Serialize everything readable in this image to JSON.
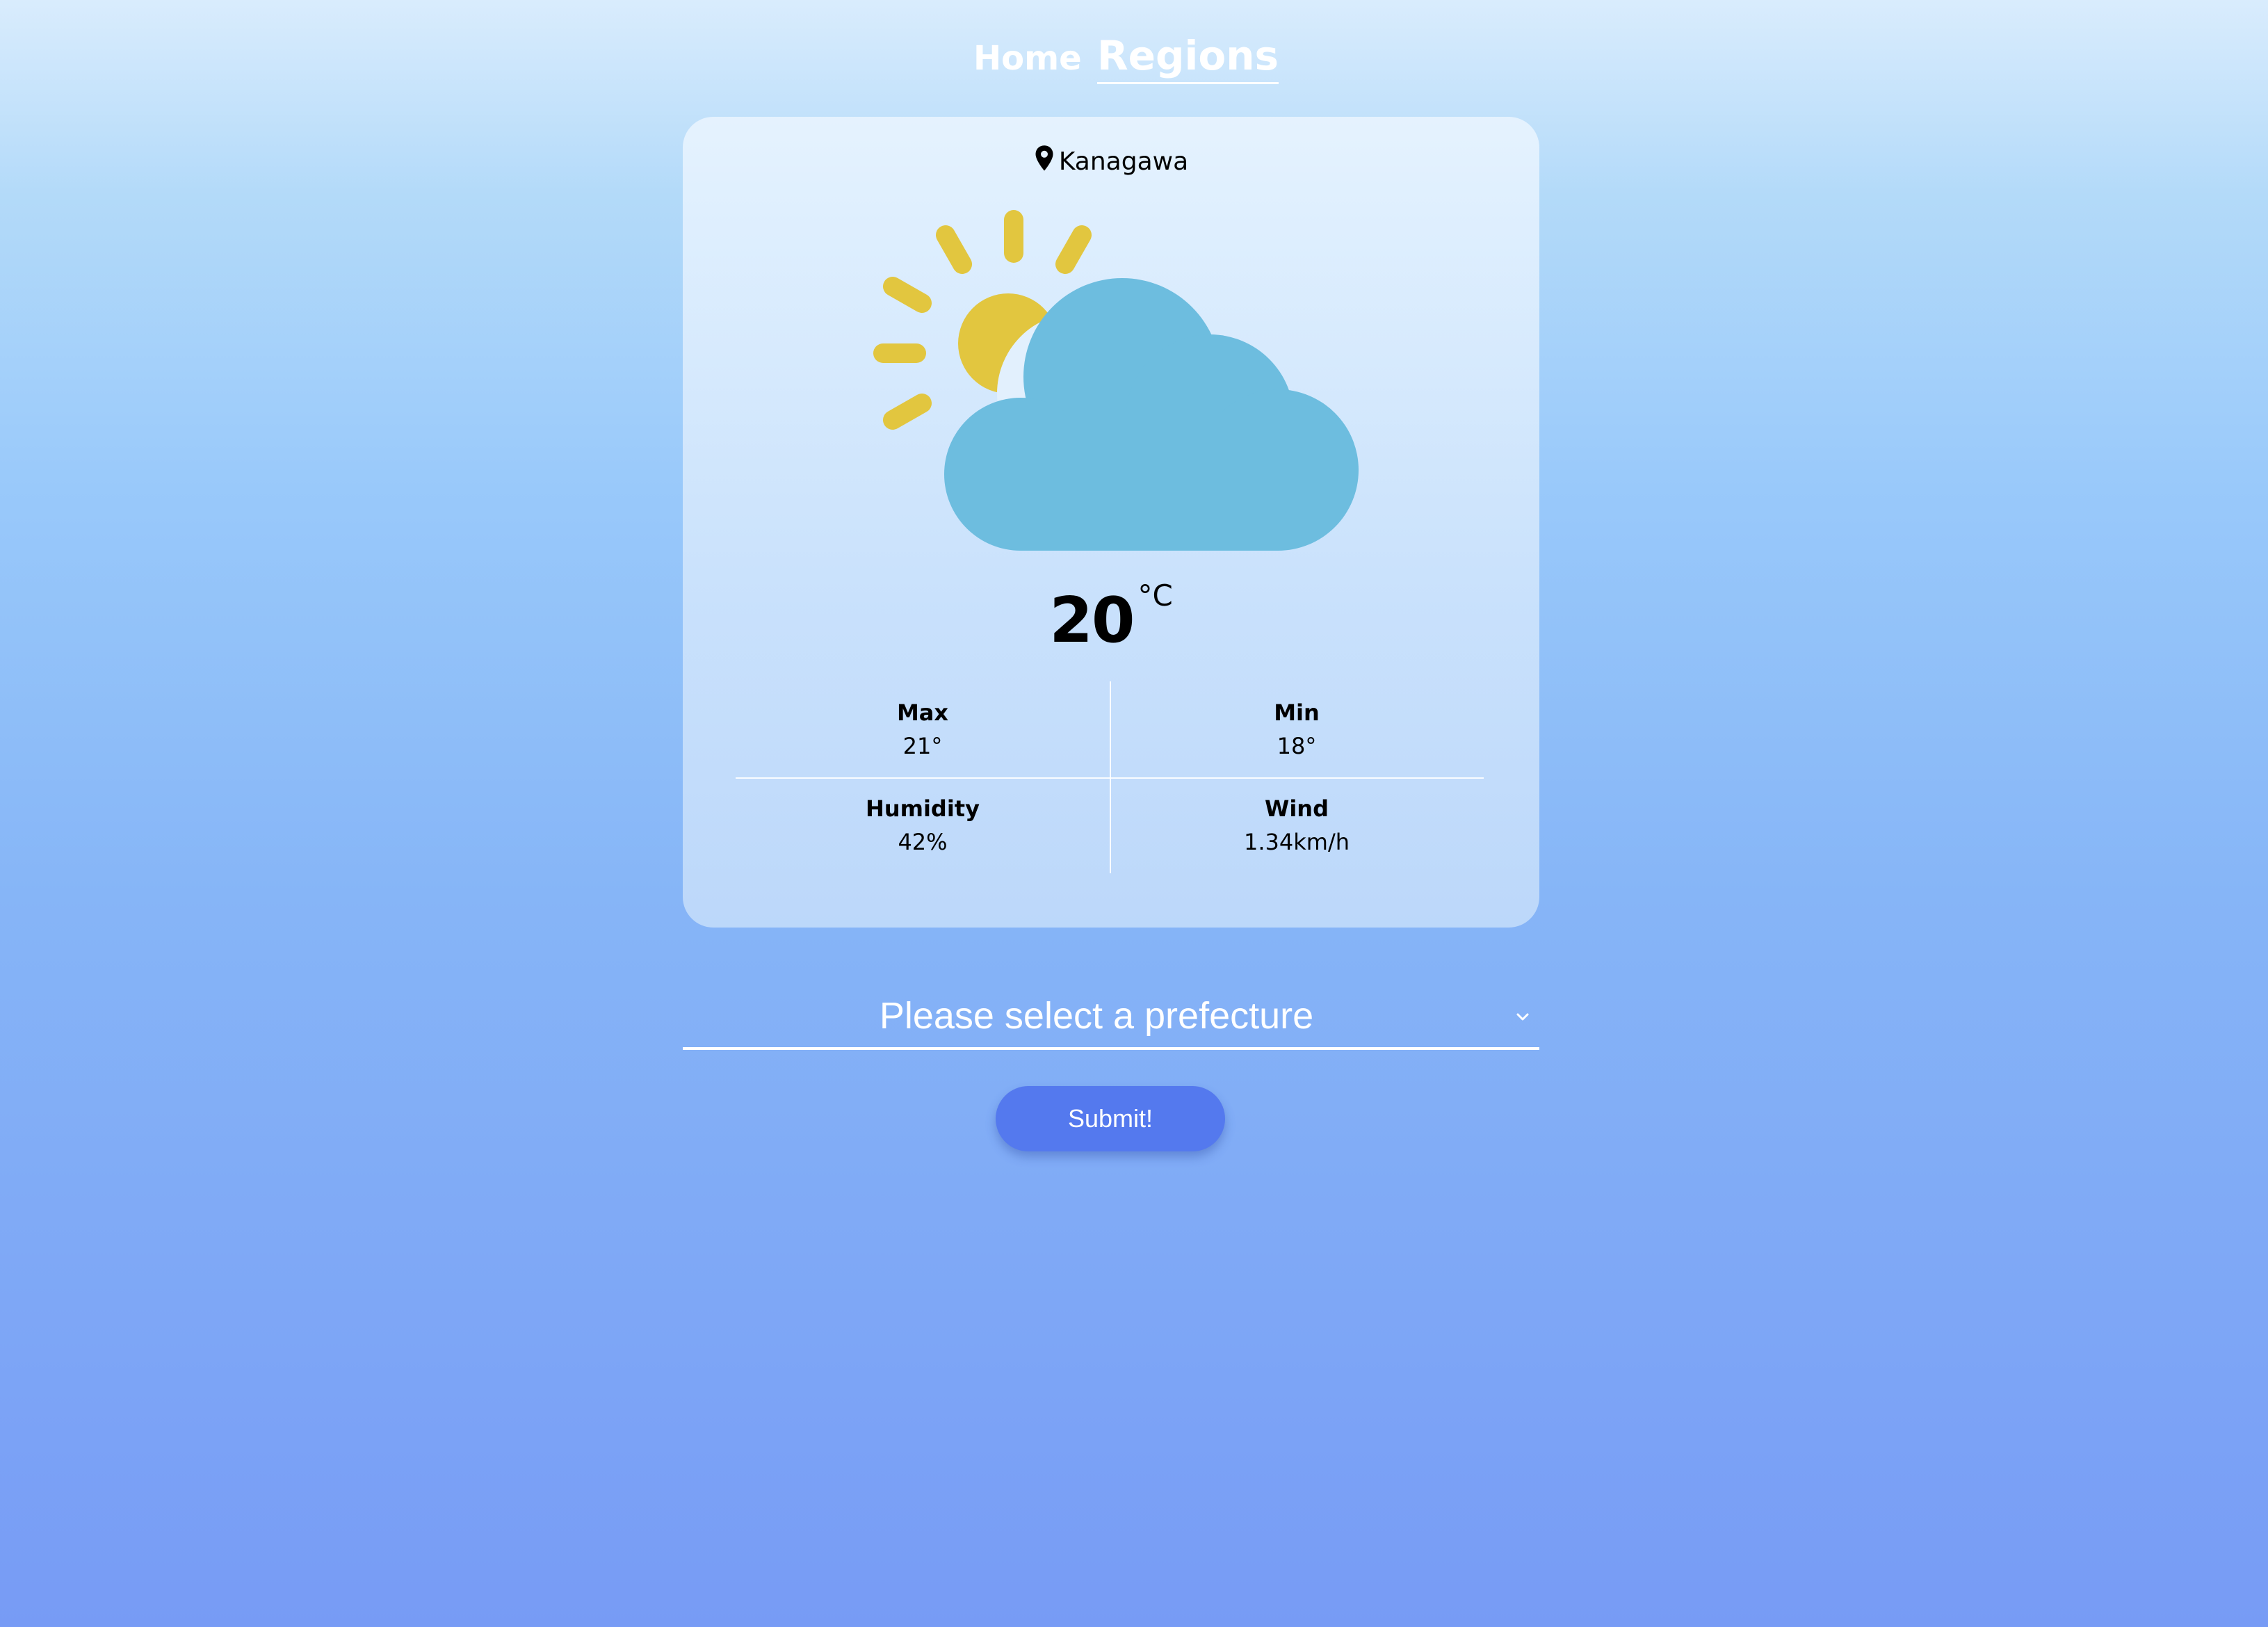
{
  "nav": {
    "home_label": "Home",
    "regions_label": "Regions",
    "active": "Regions"
  },
  "card": {
    "location": "Kanagawa",
    "icon": "partly-cloudy-icon",
    "temperature": "20",
    "temperature_unit": "°C",
    "stats": {
      "max": {
        "label": "Max",
        "value": "21°"
      },
      "min": {
        "label": "Min",
        "value": "18°"
      },
      "humidity": {
        "label": "Humidity",
        "value": "42%"
      },
      "wind": {
        "label": "Wind",
        "value": "1.34km/h"
      }
    }
  },
  "form": {
    "select_placeholder": "Please select a prefecture",
    "submit_label": "Submit!"
  },
  "colors": {
    "accent": "#5479ee",
    "sun": "#e2c63f",
    "cloud": "#6dbddf"
  }
}
